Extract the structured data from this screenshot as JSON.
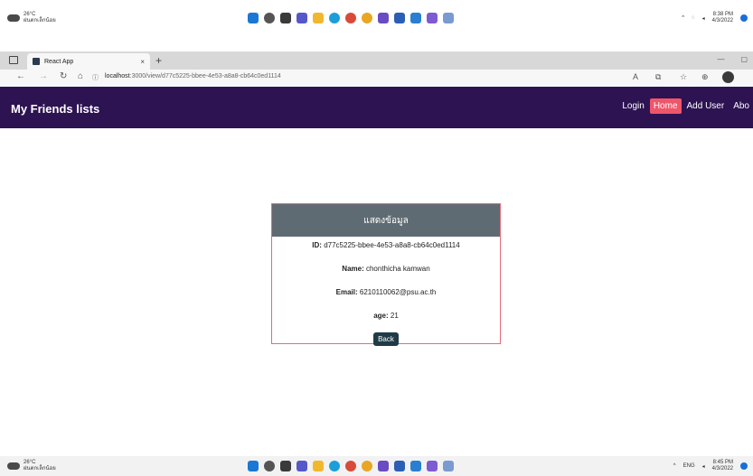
{
  "taskbar_top": {
    "weather_temp": "26°C",
    "weather_desc": "ฝนตกเล็กน้อย",
    "time": "8:38 PM",
    "date": "4/3/2022"
  },
  "taskbar_bottom": {
    "weather_temp": "26°C",
    "weather_desc": "ฝนตกเล็กน้อย",
    "lang": "ENG",
    "time": "8:45 PM",
    "date": "4/3/2022"
  },
  "browser": {
    "tab_title": "React App",
    "url_host": "localhost",
    "url_path": ":3000/view/d77c5225-bbee-4e53-a8a8-cb64c0ed1114"
  },
  "navbar": {
    "brand": "My Friends lists",
    "links": [
      "Login",
      "Home",
      "Add User",
      "Abo"
    ]
  },
  "card": {
    "header": "แสดงข้อมูล",
    "id_label": "ID:",
    "id_value": "d77c5225-bbee-4e53-a8a8-cb64c0ed1114",
    "name_label": "Name:",
    "name_value": "chonthicha kamwan",
    "email_label": "Email:",
    "email_value": "6210110062@psu.ac.th",
    "age_label": "age:",
    "age_value": "21",
    "back_label": "Back"
  },
  "colors": {
    "navbar_bg": "#2d1352",
    "active_link": "#f0566a",
    "card_header": "#5f6b72",
    "card_border": "#e46a7a",
    "back_button": "#1f3b46"
  }
}
